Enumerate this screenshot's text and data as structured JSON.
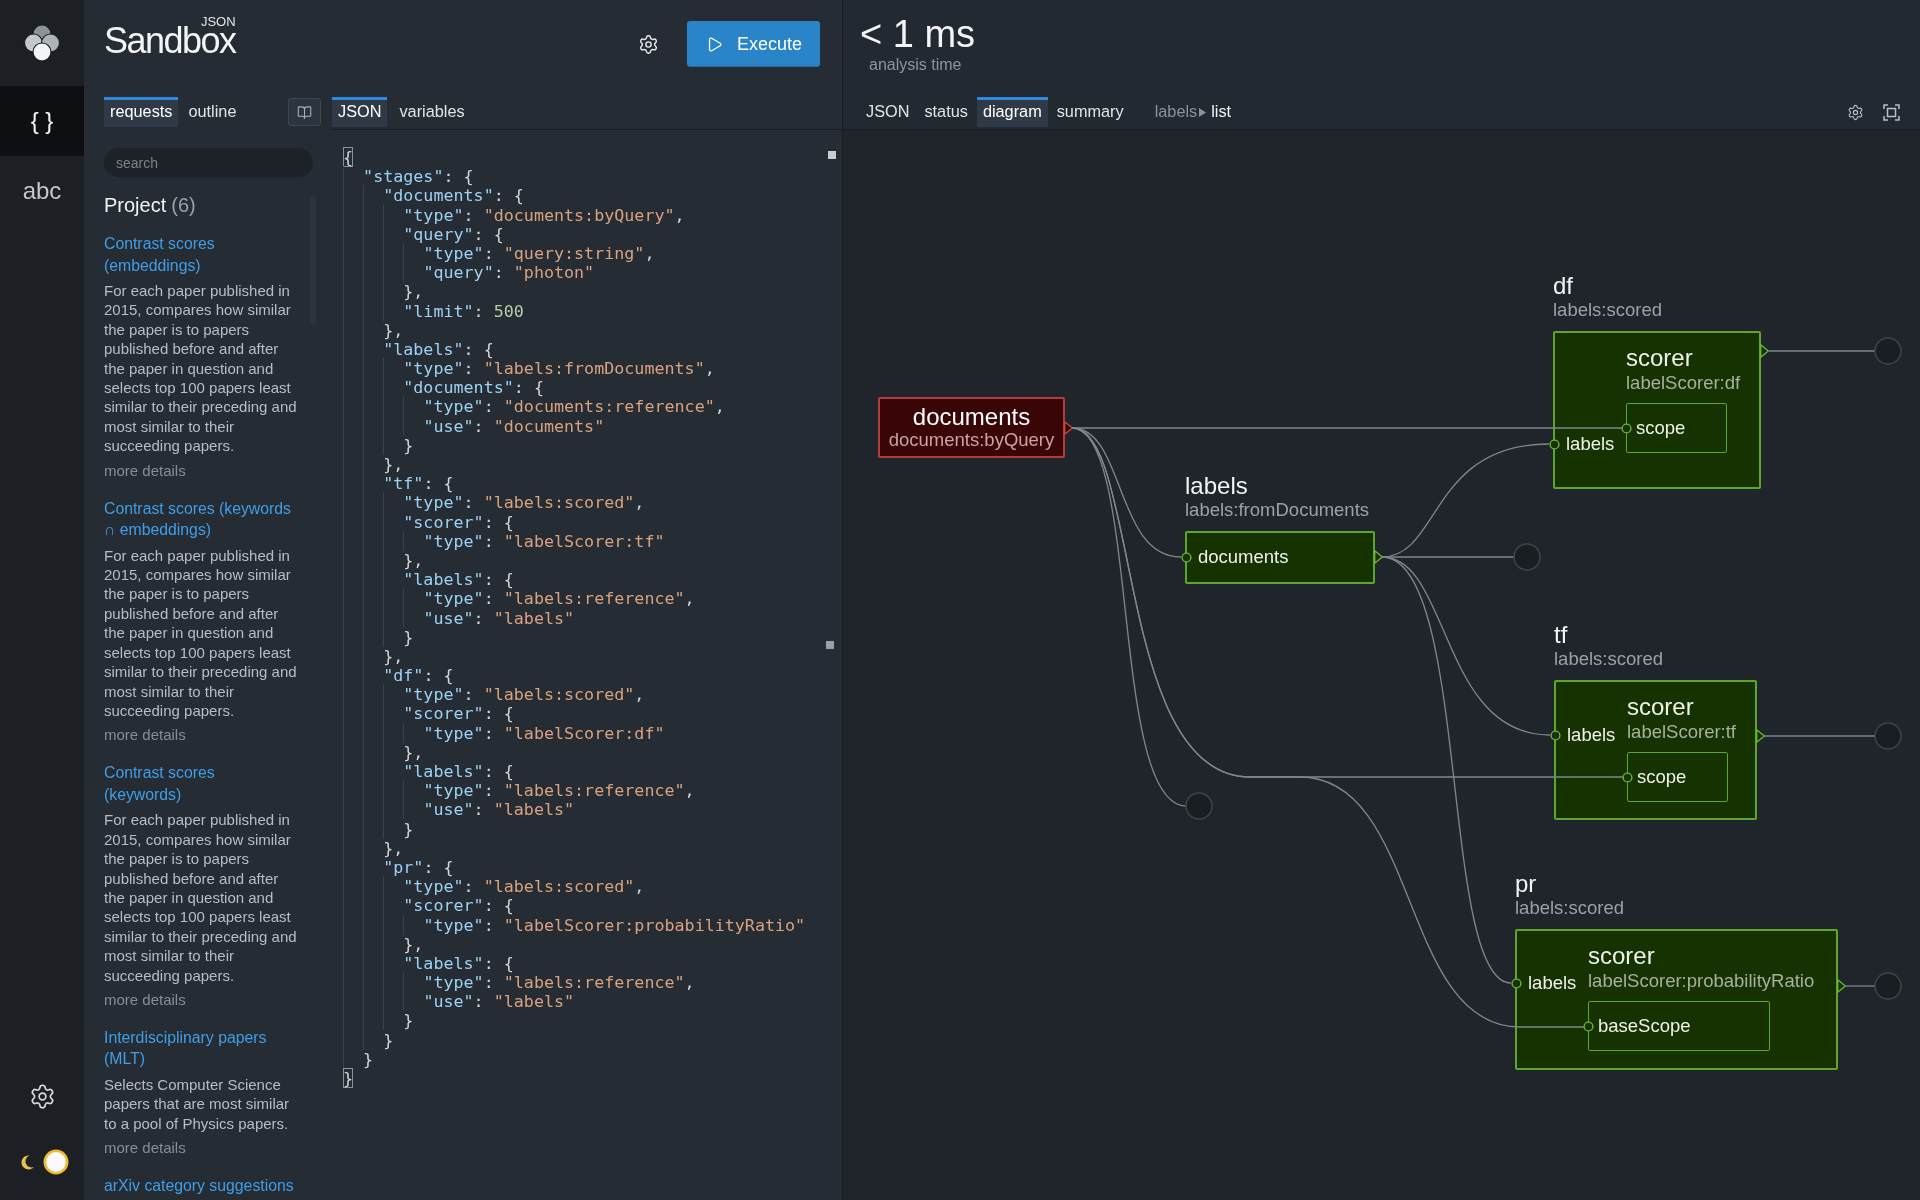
{
  "rail": {
    "items": [
      {
        "glyph": "{ }",
        "selected": true
      },
      {
        "glyph": "abc",
        "selected": false
      }
    ],
    "theme_switch": {
      "on": true
    }
  },
  "header": {
    "title_small": "JSON",
    "title": "Sandbox",
    "execute_button": {
      "label": "Execute"
    }
  },
  "side_tabs": [
    {
      "label": "requests",
      "selected": true
    },
    {
      "label": "outline",
      "selected": false
    }
  ],
  "editor_tabs": [
    {
      "label": "JSON",
      "selected": true
    },
    {
      "label": "variables",
      "selected": false
    }
  ],
  "requests": {
    "search": {
      "placeholder": "search"
    },
    "group": {
      "title": "Project",
      "count": "(6)"
    },
    "items": [
      {
        "title": "Contrast scores (embeddings)",
        "description": "For each paper published in 2015, compares how similar the paper is to papers published before and after the paper in question and selects top 100 papers least similar to their preceding and most similar to their succeeding papers.",
        "more": "more details"
      },
      {
        "title": "Contrast scores (keywords ∩ embeddings)",
        "description": "For each paper published in 2015, compares how similar the paper is to papers published before and after the paper in question and selects top 100 papers least similar to their preceding and most similar to their succeeding papers.",
        "more": "more details"
      },
      {
        "title": "Contrast scores (keywords)",
        "description": "For each paper published in 2015, compares how similar the paper is to papers published before and after the paper in question and selects top 100 papers least similar to their preceding and most similar to their succeeding papers.",
        "more": "more details"
      },
      {
        "title": "Interdisciplinary papers (MLT)",
        "description": "Selects Computer Science papers that are most similar to a pool of Physics papers.",
        "more": "more details"
      },
      {
        "title": "arXiv category suggestions"
      }
    ]
  },
  "editor": {
    "bracket_match": true,
    "lines": [
      "{",
      "  \"stages\": {",
      "    \"documents\": {",
      "      \"type\": \"documents:byQuery\",",
      "      \"query\": {",
      "        \"type\": \"query:string\",",
      "        \"query\": \"photon\"",
      "      },",
      "      \"limit\": 500",
      "    },",
      "    \"labels\": {",
      "      \"type\": \"labels:fromDocuments\",",
      "      \"documents\": {",
      "        \"type\": \"documents:reference\",",
      "        \"use\": \"documents\"",
      "      }",
      "    },",
      "    \"tf\": {",
      "      \"type\": \"labels:scored\",",
      "      \"scorer\": {",
      "        \"type\": \"labelScorer:tf\"",
      "      },",
      "      \"labels\": {",
      "        \"type\": \"labels:reference\",",
      "        \"use\": \"labels\"",
      "      }",
      "    },",
      "    \"df\": {",
      "      \"type\": \"labels:scored\",",
      "      \"scorer\": {",
      "        \"type\": \"labelScorer:df\"",
      "      },",
      "      \"labels\": {",
      "        \"type\": \"labels:reference\",",
      "        \"use\": \"labels\"",
      "      }",
      "    },",
      "    \"pr\": {",
      "      \"type\": \"labels:scored\",",
      "      \"scorer\": {",
      "        \"type\": \"labelScorer:probabilityRatio\"",
      "      },",
      "      \"labels\": {",
      "        \"type\": \"labels:reference\",",
      "        \"use\": \"labels\"",
      "      }",
      "    }",
      "  }",
      "}"
    ]
  },
  "analysis": {
    "value": "< 1 ms",
    "caption": "analysis time"
  },
  "result_tabs": [
    {
      "label": "JSON",
      "selected": false
    },
    {
      "label": "status",
      "selected": false
    },
    {
      "label": "diagram",
      "selected": true
    },
    {
      "label": "summary",
      "selected": false
    }
  ],
  "result_path": [
    {
      "label": "labels",
      "selected": false
    },
    {
      "label": "list",
      "selected": true
    }
  ],
  "diagram": {
    "stages": [
      {
        "name": "documents",
        "type": "documents:byQuery",
        "kind": "documents"
      },
      {
        "name": "labels",
        "type": "labels:fromDocuments",
        "kind": "labels",
        "inputs": [
          {
            "name": "documents"
          }
        ]
      },
      {
        "name": "df",
        "type": "labels:scored",
        "kind": "labels",
        "inputs": [
          {
            "name": "labels"
          }
        ],
        "components": [
          {
            "name": "scorer",
            "type": "labelScorer:df",
            "inputs": [
              {
                "name": "scope"
              }
            ]
          }
        ]
      },
      {
        "name": "tf",
        "type": "labels:scored",
        "kind": "labels",
        "inputs": [
          {
            "name": "labels"
          }
        ],
        "components": [
          {
            "name": "scorer",
            "type": "labelScorer:tf",
            "inputs": [
              {
                "name": "scope"
              }
            ]
          }
        ]
      },
      {
        "name": "pr",
        "type": "labels:scored",
        "kind": "labels",
        "inputs": [
          {
            "name": "labels"
          }
        ],
        "components": [
          {
            "name": "scorer",
            "type": "labelScorer:probabilityRatio",
            "inputs": [
              {
                "name": "baseScope"
              }
            ]
          }
        ]
      }
    ]
  }
}
